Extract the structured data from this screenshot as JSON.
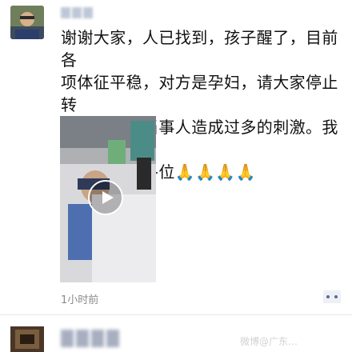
{
  "post": {
    "author_name": "",
    "text_lines": [
      "谢谢大家，人已找到，孩子醒了，目前各",
      "项体征平稳，对方是孕妇，请大家停止转",
      "发，不要对当事人造成过多的刺激。我也",
      "替孩子谢谢各位🙏🙏🙏🙏"
    ],
    "time_ago": "1小时前",
    "video": {
      "play_icon": "play-icon"
    },
    "more_icon": "more-icon"
  },
  "watermark": "微博@广东…"
}
